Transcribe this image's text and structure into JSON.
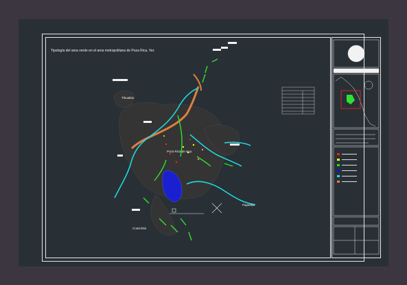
{
  "drawing": {
    "title": "Tipología del area verde en el area metropolitana de Poza Rica, Ver."
  },
  "places": {
    "tihuatlan": "Tihuatlan",
    "poza_rica": "Poza Rica de Hgo.",
    "papantla": "Papantla",
    "coatzintla": "Coatzintla"
  },
  "legend_colors": [
    "#ff2020",
    "#ffff00",
    "#20e020",
    "#1010ff",
    "#20e0e0",
    "#ff8040"
  ],
  "palette": {
    "background": "#3b3640",
    "sheet": "#283036",
    "frame": "#e8e8e8",
    "river": "#20d8e0",
    "green_area": "#30e030",
    "road": "#ff9040",
    "urban": "#3a3a3a",
    "water_body": "#1a20d0"
  }
}
